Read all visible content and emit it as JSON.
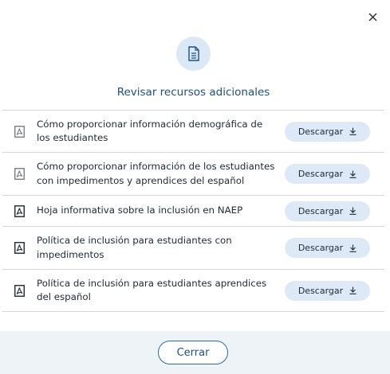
{
  "dialog": {
    "title": "Revisar recursos adicionales",
    "close_icon": "close-icon",
    "header_icon": "document-icon",
    "resources": [
      {
        "label": "Cómo proporcionar información demográfica de los estudiantes",
        "action": "Descargar",
        "icon": "pdf-icon-light"
      },
      {
        "label": "Cómo proporcionar información de los estudiantes con impedimentos y aprendices del español",
        "action": "Descargar",
        "icon": "pdf-icon-light"
      },
      {
        "label": "Hoja informativa sobre la inclusión en NAEP",
        "action": "Descargar",
        "icon": "pdf-icon"
      },
      {
        "label": "Política de inclusión para estudiantes con impedimentos",
        "action": "Descargar",
        "icon": "pdf-icon"
      },
      {
        "label": "Política de inclusión para estudiantes aprendices del español",
        "action": "Descargar",
        "icon": "pdf-icon"
      }
    ],
    "close_button": "Cerrar"
  },
  "colors": {
    "accent": "#1f4f82",
    "button_bg": "#dde9f6",
    "footer_bg": "#eef3f8",
    "divider": "#d4d8dc"
  }
}
